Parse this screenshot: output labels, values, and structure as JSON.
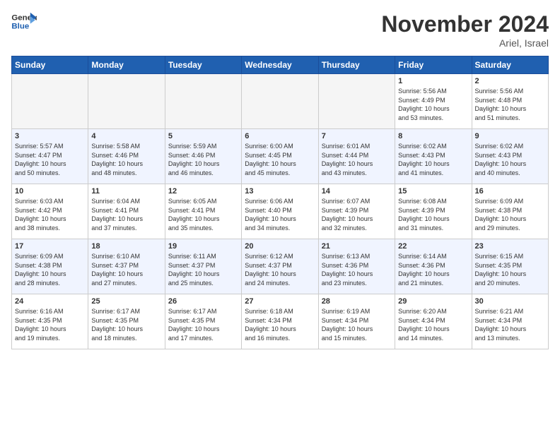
{
  "header": {
    "logo_general": "General",
    "logo_blue": "Blue",
    "month_title": "November 2024",
    "subtitle": "Ariel, Israel"
  },
  "weekdays": [
    "Sunday",
    "Monday",
    "Tuesday",
    "Wednesday",
    "Thursday",
    "Friday",
    "Saturday"
  ],
  "weeks": [
    [
      {
        "day": "",
        "info": ""
      },
      {
        "day": "",
        "info": ""
      },
      {
        "day": "",
        "info": ""
      },
      {
        "day": "",
        "info": ""
      },
      {
        "day": "",
        "info": ""
      },
      {
        "day": "1",
        "info": "Sunrise: 5:56 AM\nSunset: 4:49 PM\nDaylight: 10 hours\nand 53 minutes."
      },
      {
        "day": "2",
        "info": "Sunrise: 5:56 AM\nSunset: 4:48 PM\nDaylight: 10 hours\nand 51 minutes."
      }
    ],
    [
      {
        "day": "3",
        "info": "Sunrise: 5:57 AM\nSunset: 4:47 PM\nDaylight: 10 hours\nand 50 minutes."
      },
      {
        "day": "4",
        "info": "Sunrise: 5:58 AM\nSunset: 4:46 PM\nDaylight: 10 hours\nand 48 minutes."
      },
      {
        "day": "5",
        "info": "Sunrise: 5:59 AM\nSunset: 4:46 PM\nDaylight: 10 hours\nand 46 minutes."
      },
      {
        "day": "6",
        "info": "Sunrise: 6:00 AM\nSunset: 4:45 PM\nDaylight: 10 hours\nand 45 minutes."
      },
      {
        "day": "7",
        "info": "Sunrise: 6:01 AM\nSunset: 4:44 PM\nDaylight: 10 hours\nand 43 minutes."
      },
      {
        "day": "8",
        "info": "Sunrise: 6:02 AM\nSunset: 4:43 PM\nDaylight: 10 hours\nand 41 minutes."
      },
      {
        "day": "9",
        "info": "Sunrise: 6:02 AM\nSunset: 4:43 PM\nDaylight: 10 hours\nand 40 minutes."
      }
    ],
    [
      {
        "day": "10",
        "info": "Sunrise: 6:03 AM\nSunset: 4:42 PM\nDaylight: 10 hours\nand 38 minutes."
      },
      {
        "day": "11",
        "info": "Sunrise: 6:04 AM\nSunset: 4:41 PM\nDaylight: 10 hours\nand 37 minutes."
      },
      {
        "day": "12",
        "info": "Sunrise: 6:05 AM\nSunset: 4:41 PM\nDaylight: 10 hours\nand 35 minutes."
      },
      {
        "day": "13",
        "info": "Sunrise: 6:06 AM\nSunset: 4:40 PM\nDaylight: 10 hours\nand 34 minutes."
      },
      {
        "day": "14",
        "info": "Sunrise: 6:07 AM\nSunset: 4:39 PM\nDaylight: 10 hours\nand 32 minutes."
      },
      {
        "day": "15",
        "info": "Sunrise: 6:08 AM\nSunset: 4:39 PM\nDaylight: 10 hours\nand 31 minutes."
      },
      {
        "day": "16",
        "info": "Sunrise: 6:09 AM\nSunset: 4:38 PM\nDaylight: 10 hours\nand 29 minutes."
      }
    ],
    [
      {
        "day": "17",
        "info": "Sunrise: 6:09 AM\nSunset: 4:38 PM\nDaylight: 10 hours\nand 28 minutes."
      },
      {
        "day": "18",
        "info": "Sunrise: 6:10 AM\nSunset: 4:37 PM\nDaylight: 10 hours\nand 27 minutes."
      },
      {
        "day": "19",
        "info": "Sunrise: 6:11 AM\nSunset: 4:37 PM\nDaylight: 10 hours\nand 25 minutes."
      },
      {
        "day": "20",
        "info": "Sunrise: 6:12 AM\nSunset: 4:37 PM\nDaylight: 10 hours\nand 24 minutes."
      },
      {
        "day": "21",
        "info": "Sunrise: 6:13 AM\nSunset: 4:36 PM\nDaylight: 10 hours\nand 23 minutes."
      },
      {
        "day": "22",
        "info": "Sunrise: 6:14 AM\nSunset: 4:36 PM\nDaylight: 10 hours\nand 21 minutes."
      },
      {
        "day": "23",
        "info": "Sunrise: 6:15 AM\nSunset: 4:35 PM\nDaylight: 10 hours\nand 20 minutes."
      }
    ],
    [
      {
        "day": "24",
        "info": "Sunrise: 6:16 AM\nSunset: 4:35 PM\nDaylight: 10 hours\nand 19 minutes."
      },
      {
        "day": "25",
        "info": "Sunrise: 6:17 AM\nSunset: 4:35 PM\nDaylight: 10 hours\nand 18 minutes."
      },
      {
        "day": "26",
        "info": "Sunrise: 6:17 AM\nSunset: 4:35 PM\nDaylight: 10 hours\nand 17 minutes."
      },
      {
        "day": "27",
        "info": "Sunrise: 6:18 AM\nSunset: 4:34 PM\nDaylight: 10 hours\nand 16 minutes."
      },
      {
        "day": "28",
        "info": "Sunrise: 6:19 AM\nSunset: 4:34 PM\nDaylight: 10 hours\nand 15 minutes."
      },
      {
        "day": "29",
        "info": "Sunrise: 6:20 AM\nSunset: 4:34 PM\nDaylight: 10 hours\nand 14 minutes."
      },
      {
        "day": "30",
        "info": "Sunrise: 6:21 AM\nSunset: 4:34 PM\nDaylight: 10 hours\nand 13 minutes."
      }
    ]
  ]
}
